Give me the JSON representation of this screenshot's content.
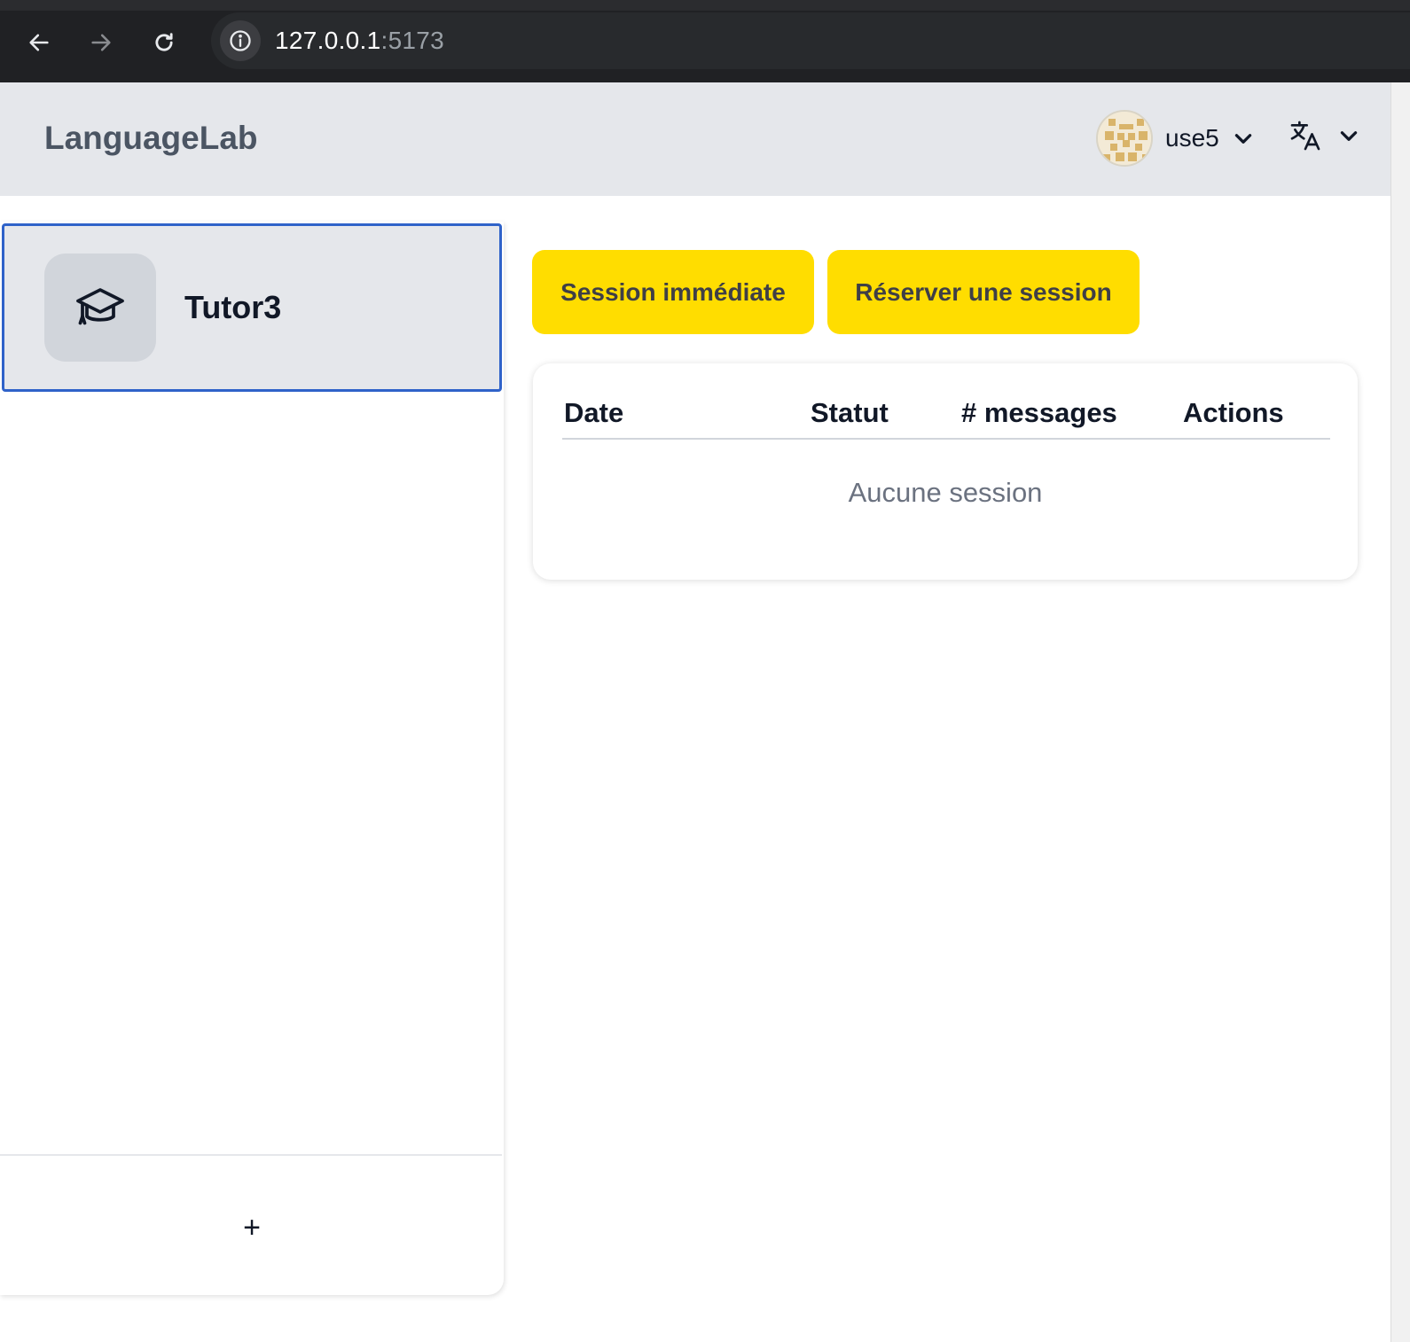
{
  "browser": {
    "url_host": "127.0.0.1",
    "url_port": ":5173",
    "icons": [
      "back-arrow-icon",
      "forward-arrow-icon",
      "reload-icon",
      "info-icon"
    ]
  },
  "header": {
    "brand": "LanguageLab",
    "user": {
      "username": "use5",
      "avatar_icon": "identicon-avatar"
    },
    "language_icon": "translate-icon"
  },
  "sidebar": {
    "tutors": [
      {
        "name": "Tutor3",
        "icon": "graduation-cap-icon",
        "selected": true
      }
    ],
    "add_label": "+"
  },
  "main": {
    "buttons": {
      "immediate": "Session immédiate",
      "reserve": "Réserver une session"
    },
    "table": {
      "columns": [
        "Date",
        "Statut",
        "# messages",
        "Actions"
      ],
      "empty_text": "Aucune session"
    }
  },
  "colors": {
    "accent_yellow": "#ffdd00",
    "selected_border": "#2f62c9",
    "header_bg": "#e5e7eb"
  }
}
